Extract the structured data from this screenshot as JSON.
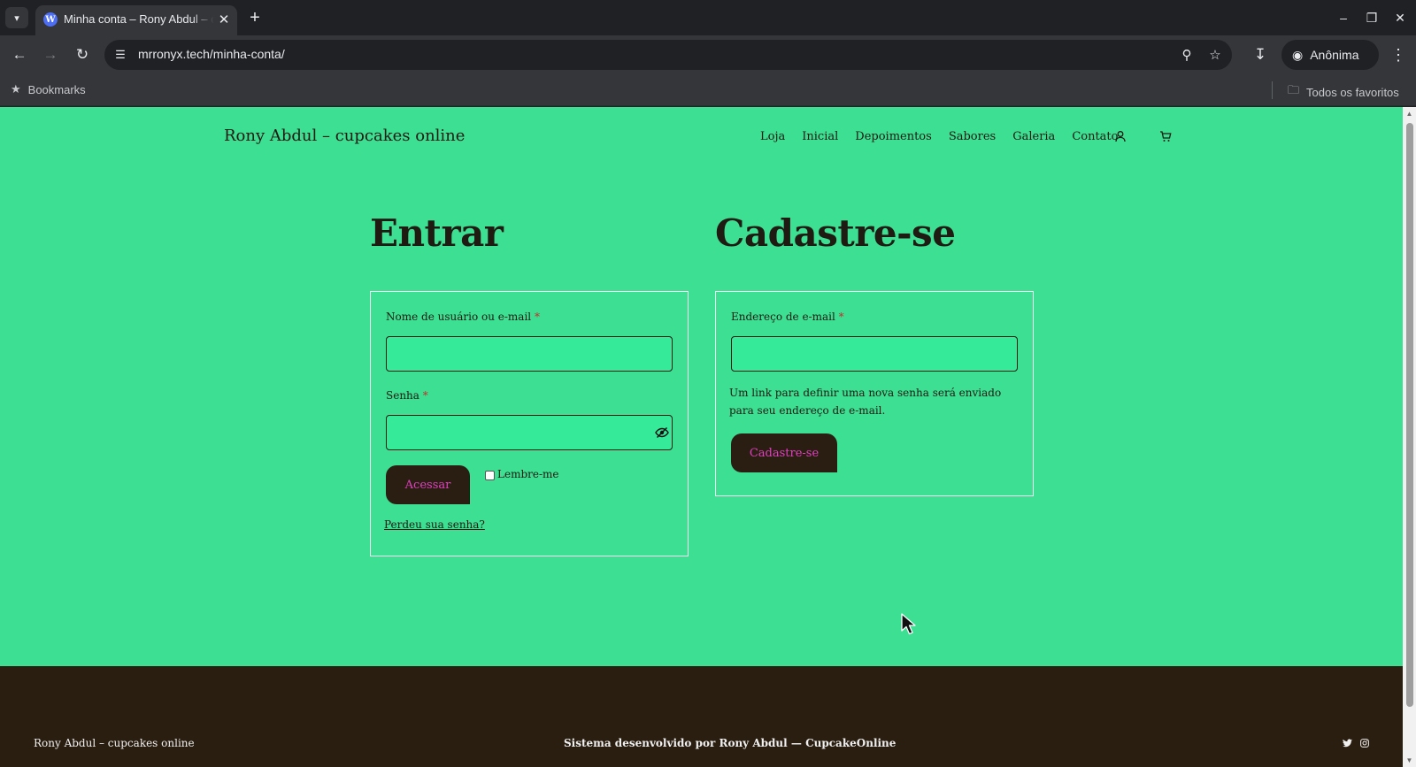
{
  "browser": {
    "tab": {
      "title": "Minha conta – Rony Abdul – cupcakes online",
      "favicon": "wordpress-icon"
    },
    "url": "mrronyx.tech/minha-conta/",
    "incognito_label": "Anônima",
    "bookmarks_label": "Bookmarks",
    "all_bookmarks_label": "Todos os favoritos"
  },
  "site": {
    "title": "Rony Abdul – cupcakes online",
    "nav": [
      "Loja",
      "Inicial",
      "Depoimentos",
      "Sabores",
      "Galeria",
      "Contato"
    ]
  },
  "login": {
    "heading": "Entrar",
    "username_label": "Nome de usuário ou e-mail",
    "password_label": "Senha",
    "required_mark": "*",
    "submit_label": "Acessar",
    "remember_label": "Lembre-me",
    "lost_password_label": "Perdeu sua senha?"
  },
  "register": {
    "heading": "Cadastre-se",
    "email_label": "Endereço de e-mail",
    "required_mark": "*",
    "info_text": "Um link para definir uma nova senha será enviado para seu endereço de e-mail.",
    "submit_label": "Cadastre-se"
  },
  "footer": {
    "site_title": "Rony Abdul – cupcakes online",
    "credit": "Sistema desenvolvido por Rony Abdul — CupcakeOnline"
  },
  "colors": {
    "page_background": "#3ddf92",
    "footer_background": "#2a1e10",
    "button_background": "#2a1e12",
    "button_text": "#e040c0"
  }
}
